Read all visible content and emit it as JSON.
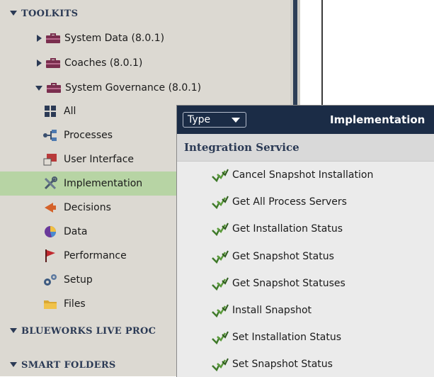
{
  "tree": {
    "toolkits_header": "TOOLKITS",
    "toolkits": [
      {
        "label": "System Data (8.0.1)",
        "expanded": false
      },
      {
        "label": "Coaches (8.0.1)",
        "expanded": false
      },
      {
        "label": "System Governance (8.0.1)",
        "expanded": true
      }
    ],
    "categories": [
      {
        "label": "All",
        "icon": "grid-icon"
      },
      {
        "label": "Processes",
        "icon": "processes-icon"
      },
      {
        "label": "User Interface",
        "icon": "user-interface-icon"
      },
      {
        "label": "Implementation",
        "icon": "implementation-icon",
        "selected": true
      },
      {
        "label": "Decisions",
        "icon": "decisions-icon"
      },
      {
        "label": "Data",
        "icon": "data-pie-icon"
      },
      {
        "label": "Performance",
        "icon": "flag-icon"
      },
      {
        "label": "Setup",
        "icon": "gears-icon"
      },
      {
        "label": "Files",
        "icon": "folder-icon"
      }
    ],
    "blueworks_header": "BLUEWORKS LIVE PROC",
    "smart_folders_header": "SMART FOLDERS"
  },
  "popup": {
    "type_filter_label": "Type",
    "title": "Implementation",
    "group_label": "Integration Service",
    "items": [
      "Cancel Snapshot Installation",
      "Get All Process Servers",
      "Get Installation Status",
      "Get Snapshot Status",
      "Get Snapshot Statuses",
      "Install Snapshot",
      "Set Installation Status",
      "Set Snapshot Status"
    ]
  },
  "colors": {
    "tree_background": "#dcd9d2",
    "header_text": "#2b3a55",
    "selected_row": "#b7d4a4",
    "popup_header": "#1b2c46",
    "toolkit_icon": "#7a2e4e"
  }
}
